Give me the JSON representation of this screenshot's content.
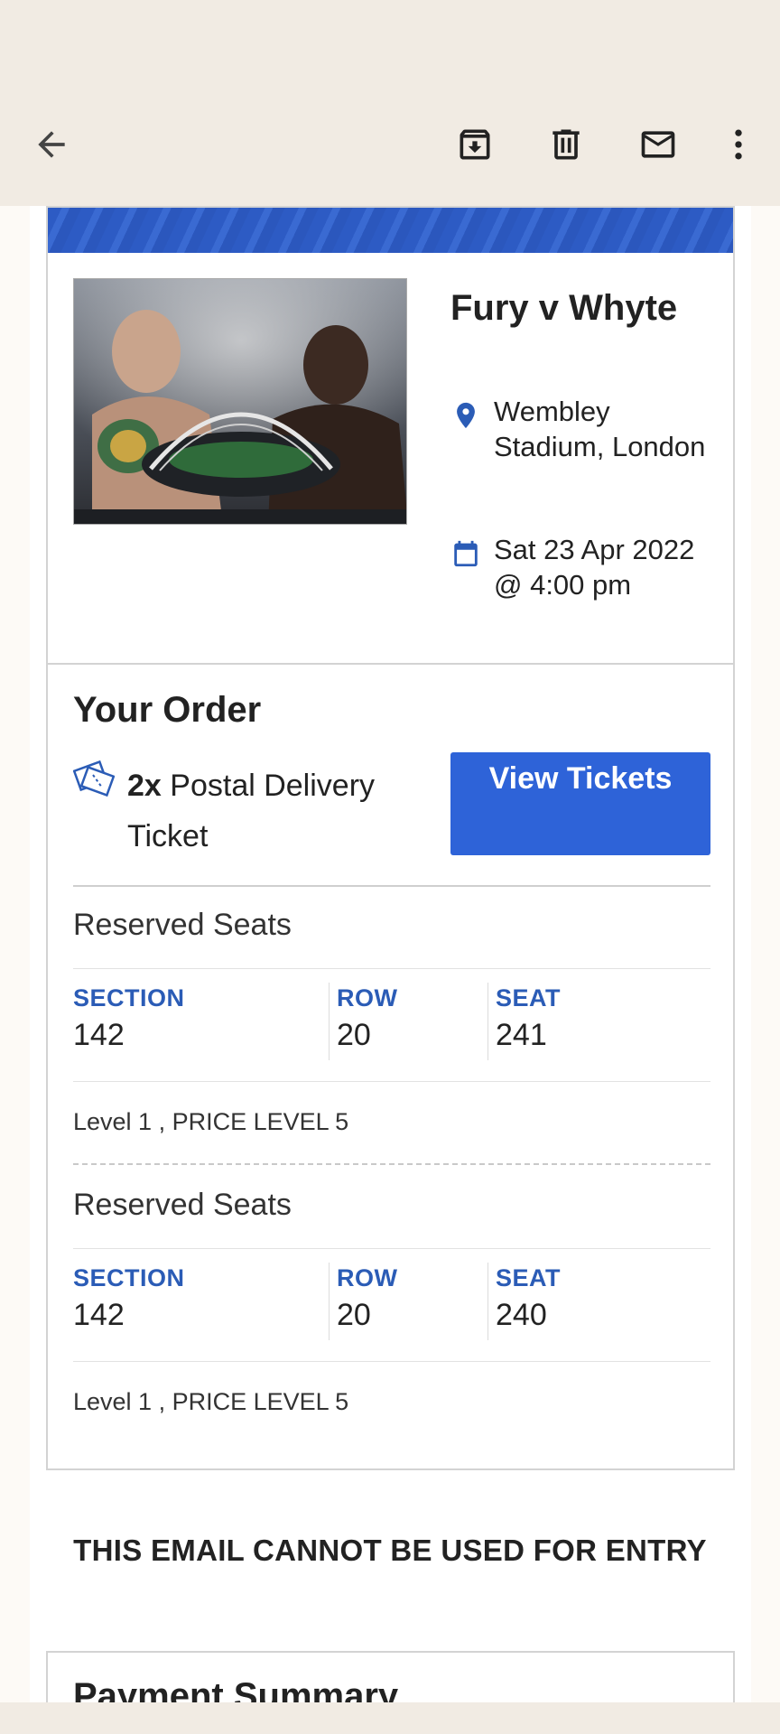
{
  "toolbar": {
    "back_icon": "arrow-left-icon",
    "archive_icon": "archive-icon",
    "delete_icon": "trash-icon",
    "unread_icon": "mail-icon",
    "more_icon": "more-vert-icon"
  },
  "event": {
    "image_icon": "event-poster",
    "title": "Fury v Whyte",
    "venue": "Wembley Stadium, London",
    "datetime": "Sat 23 Apr 2022 @ 4:00 pm"
  },
  "order": {
    "title": "Your Order",
    "quantity": "2x",
    "ticket_type": "Postal Delivery Ticket",
    "view_button": "View Tickets",
    "seats": [
      {
        "heading": "Reserved Seats",
        "section_label": "SECTION",
        "section": "142",
        "row_label": "ROW",
        "row": "20",
        "seat_label": "SEAT",
        "seat": "241",
        "level": "Level 1 , PRICE LEVEL 5"
      },
      {
        "heading": "Reserved Seats",
        "section_label": "SECTION",
        "section": "142",
        "row_label": "ROW",
        "row": "20",
        "seat_label": "SEAT",
        "seat": "240",
        "level": "Level 1 , PRICE LEVEL 5"
      }
    ]
  },
  "notice": "THIS EMAIL CANNOT BE USED FOR ENTRY",
  "payment": {
    "title": "Payment Summary"
  },
  "colors": {
    "app_bg": "#f1ebe3",
    "accent_blue": "#2e63d8",
    "label_blue": "#2b5cb6",
    "banner_blue": "#2d5bc4"
  }
}
